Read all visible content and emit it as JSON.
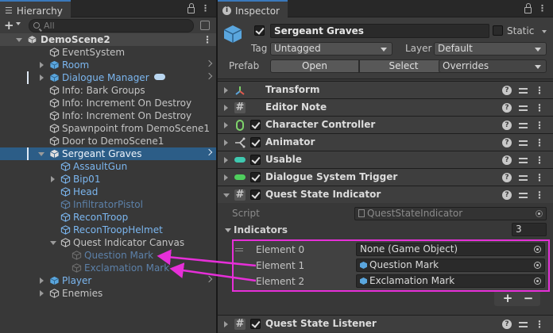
{
  "hierarchy": {
    "tab_title": "Hierarchy",
    "search_placeholder": "All",
    "scene": "DemoScene2",
    "items": [
      {
        "label": "EventSystem"
      },
      {
        "label": "Room"
      },
      {
        "label": "Dialogue Manager"
      },
      {
        "label": "Info: Bark Groups"
      },
      {
        "label": "Info: Increment On Destroy"
      },
      {
        "label": "Info: Increment On Destroy"
      },
      {
        "label": "Spawnpoint from DemoScene1"
      },
      {
        "label": "Door to DemoScene1"
      },
      {
        "label": "Sergeant Graves"
      },
      {
        "label": "AssaultGun"
      },
      {
        "label": "Bip01"
      },
      {
        "label": "Head"
      },
      {
        "label": "InfiltratorPistol"
      },
      {
        "label": "ReconTroop"
      },
      {
        "label": "ReconTroopHelmet"
      },
      {
        "label": "Quest Indicator Canvas"
      },
      {
        "label": "Question Mark"
      },
      {
        "label": "Exclamation Mark"
      },
      {
        "label": "Player"
      },
      {
        "label": "Enemies"
      }
    ]
  },
  "inspector": {
    "tab_title": "Inspector",
    "object_name": "Sergeant Graves",
    "static_label": "Static",
    "tag_label": "Tag",
    "tag_value": "Untagged",
    "layer_label": "Layer",
    "layer_value": "Default",
    "prefab_label": "Prefab",
    "open_button": "Open",
    "select_button": "Select",
    "overrides_value": "Overrides",
    "components": [
      {
        "name": "Transform"
      },
      {
        "name": "Editor Note"
      },
      {
        "name": "Character Controller"
      },
      {
        "name": "Animator"
      },
      {
        "name": "Usable"
      },
      {
        "name": "Dialogue System Trigger"
      },
      {
        "name": "Quest State Indicator"
      },
      {
        "name": "Quest State Listener"
      }
    ],
    "script_label": "Script",
    "script_value": "QuestStateIndicator",
    "indicators_label": "Indicators",
    "indicators_count": "3",
    "elements": [
      {
        "label": "Element 0",
        "value": "None (Game Object)"
      },
      {
        "label": "Element 1",
        "value": "Question Mark"
      },
      {
        "label": "Element 2",
        "value": "Exclamation Mark"
      }
    ],
    "add_button": "+",
    "remove_button": "−"
  },
  "colors": {
    "highlight": "#e62fd8",
    "selection": "#2c5d87",
    "accent": "#3a79bb"
  }
}
